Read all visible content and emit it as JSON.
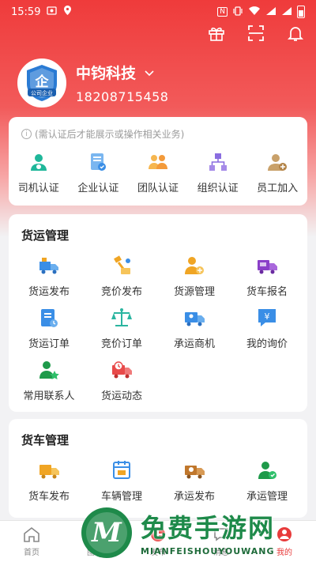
{
  "status_bar": {
    "time": "15:59",
    "signal_text": "N"
  },
  "header": {
    "company_name": "中钧科技",
    "phone": "18208715458",
    "avatar_badge": "公司企业",
    "avatar_glyph": "企"
  },
  "certification": {
    "notice": "(需认证后才能展示或操作相关业务)",
    "items": [
      {
        "label": "司机认证",
        "icon": "driver-icon",
        "color": "#1fb79a"
      },
      {
        "label": "企业认证",
        "icon": "enterprise-icon",
        "color": "#4a9ae8"
      },
      {
        "label": "团队认证",
        "icon": "team-icon",
        "color": "#f39a3a"
      },
      {
        "label": "组织认证",
        "icon": "org-icon",
        "color": "#8a6de0"
      },
      {
        "label": "员工加入",
        "icon": "employee-add-icon",
        "color": "#c9a16a"
      }
    ]
  },
  "freight": {
    "title": "货运管理",
    "items": [
      {
        "label": "货运发布",
        "icon": "freight-publish-icon",
        "color": "#3a8ee6"
      },
      {
        "label": "竞价发布",
        "icon": "bid-publish-icon",
        "color": "#f0a524"
      },
      {
        "label": "货源管理",
        "icon": "source-manage-icon",
        "color": "#f0a524"
      },
      {
        "label": "货车报名",
        "icon": "truck-signup-icon",
        "color": "#8a3fc8"
      },
      {
        "label": "货运订单",
        "icon": "freight-order-icon",
        "color": "#3a8ee6"
      },
      {
        "label": "竞价订单",
        "icon": "bid-order-icon",
        "color": "#2bb5a0"
      },
      {
        "label": "承运商机",
        "icon": "carrier-opportunity-icon",
        "color": "#3a8ee6"
      },
      {
        "label": "我的询价",
        "icon": "my-inquiry-icon",
        "color": "#3a8ee6"
      },
      {
        "label": "常用联系人",
        "icon": "contacts-icon",
        "color": "#1e9a4a"
      },
      {
        "label": "货运动态",
        "icon": "freight-news-icon",
        "color": "#e84a4a"
      }
    ]
  },
  "trucks": {
    "title": "货车管理",
    "items": [
      {
        "label": "货车发布",
        "icon": "truck-publish-icon",
        "color": "#f0a524"
      },
      {
        "label": "车辆管理",
        "icon": "vehicle-manage-icon",
        "color": "#3a8ee6"
      },
      {
        "label": "承运发布",
        "icon": "carry-publish-icon",
        "color": "#c0772c"
      },
      {
        "label": "承运管理",
        "icon": "carry-manage-icon",
        "color": "#1e9a4a"
      }
    ]
  },
  "tabbar": {
    "tabs": [
      {
        "label": "首页",
        "icon": "home-icon"
      },
      {
        "label": "图鉴",
        "icon": "catalog-icon"
      },
      {
        "label": "发布",
        "icon": "publish-icon"
      },
      {
        "label": "消息",
        "icon": "message-icon"
      },
      {
        "label": "我的",
        "icon": "profile-icon"
      }
    ]
  },
  "watermark": {
    "cn": "免费手游网",
    "en": "MIANFEISHOUYOUWANG",
    "logo_letter": "M"
  }
}
